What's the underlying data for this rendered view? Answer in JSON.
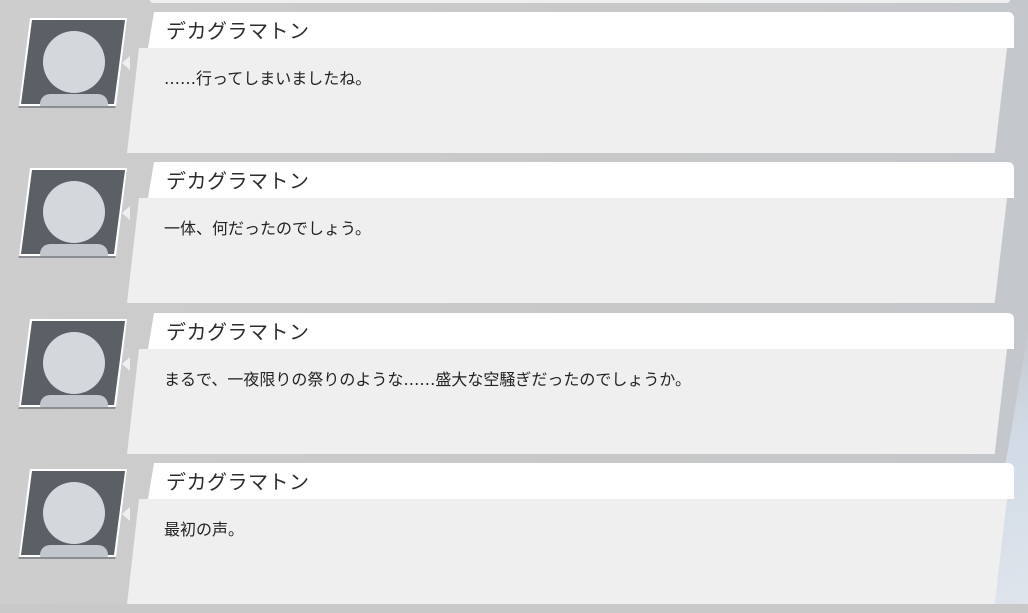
{
  "colors": {
    "background": "#c9c9c9",
    "name_bar": "#ffffff",
    "message_box": "#efefef",
    "avatar_frame": "#5b5f66",
    "avatar_silhouette": "#d4d8dd"
  },
  "avatar_icon": "default-user-silhouette-icon",
  "entries": [
    {
      "speaker": "デカグラマトン",
      "text": "……行ってしまいましたね。"
    },
    {
      "speaker": "デカグラマトン",
      "text": "一体、何だったのでしょう。"
    },
    {
      "speaker": "デカグラマトン",
      "text": "まるで、一夜限りの祭りのような……盛大な空騒ぎだったのでしょうか。"
    },
    {
      "speaker": "デカグラマトン",
      "text": "最初の声。"
    }
  ]
}
